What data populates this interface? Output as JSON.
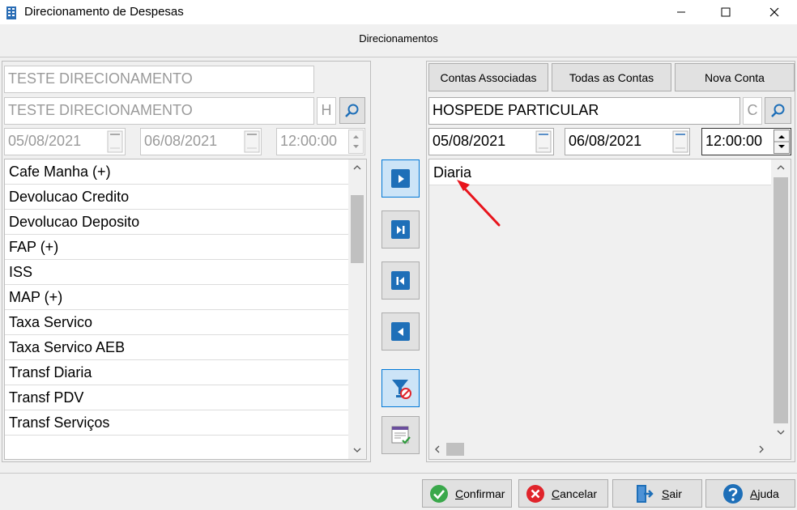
{
  "window": {
    "title": "Direcionamento de Despesas"
  },
  "header": {
    "title": "Direcionamentos"
  },
  "left": {
    "name_field": "TESTE DIRECIONAMENTO",
    "search_field": "TESTE DIRECIONAMENTO",
    "search_flag": "H",
    "date_from": "05/08/2021",
    "date_to": "06/08/2021",
    "time": "12:00:00",
    "items": [
      {
        "label": "Cafe Manha (+)"
      },
      {
        "label": "Devolucao Credito"
      },
      {
        "label": "Devolucao Deposito"
      },
      {
        "label": "FAP (+)"
      },
      {
        "label": "ISS"
      },
      {
        "label": "MAP (+)"
      },
      {
        "label": "Taxa Servico"
      },
      {
        "label": "Taxa Servico AEB"
      },
      {
        "label": "Transf Diaria"
      },
      {
        "label": "Transf PDV"
      },
      {
        "label": "Transf Serviços"
      }
    ]
  },
  "right": {
    "tabs": {
      "associated": "Contas Associadas",
      "all": "Todas as Contas",
      "new": "Nova Conta"
    },
    "search_field": "HOSPEDE PARTICULAR",
    "search_flag": "C",
    "date_from": "05/08/2021",
    "date_to": "06/08/2021",
    "time": "12:00:00",
    "items": [
      {
        "label": "Diaria"
      }
    ]
  },
  "footer": {
    "confirm": {
      "first": "C",
      "rest": "onfirmar"
    },
    "cancel": {
      "first": "C",
      "rest": "ancelar"
    },
    "exit": {
      "first": "S",
      "rest": "air"
    },
    "help": {
      "first": "A",
      "rest": "juda"
    }
  },
  "colors": {
    "accent": "#1e6fb8",
    "arrow": "#e8141c"
  }
}
